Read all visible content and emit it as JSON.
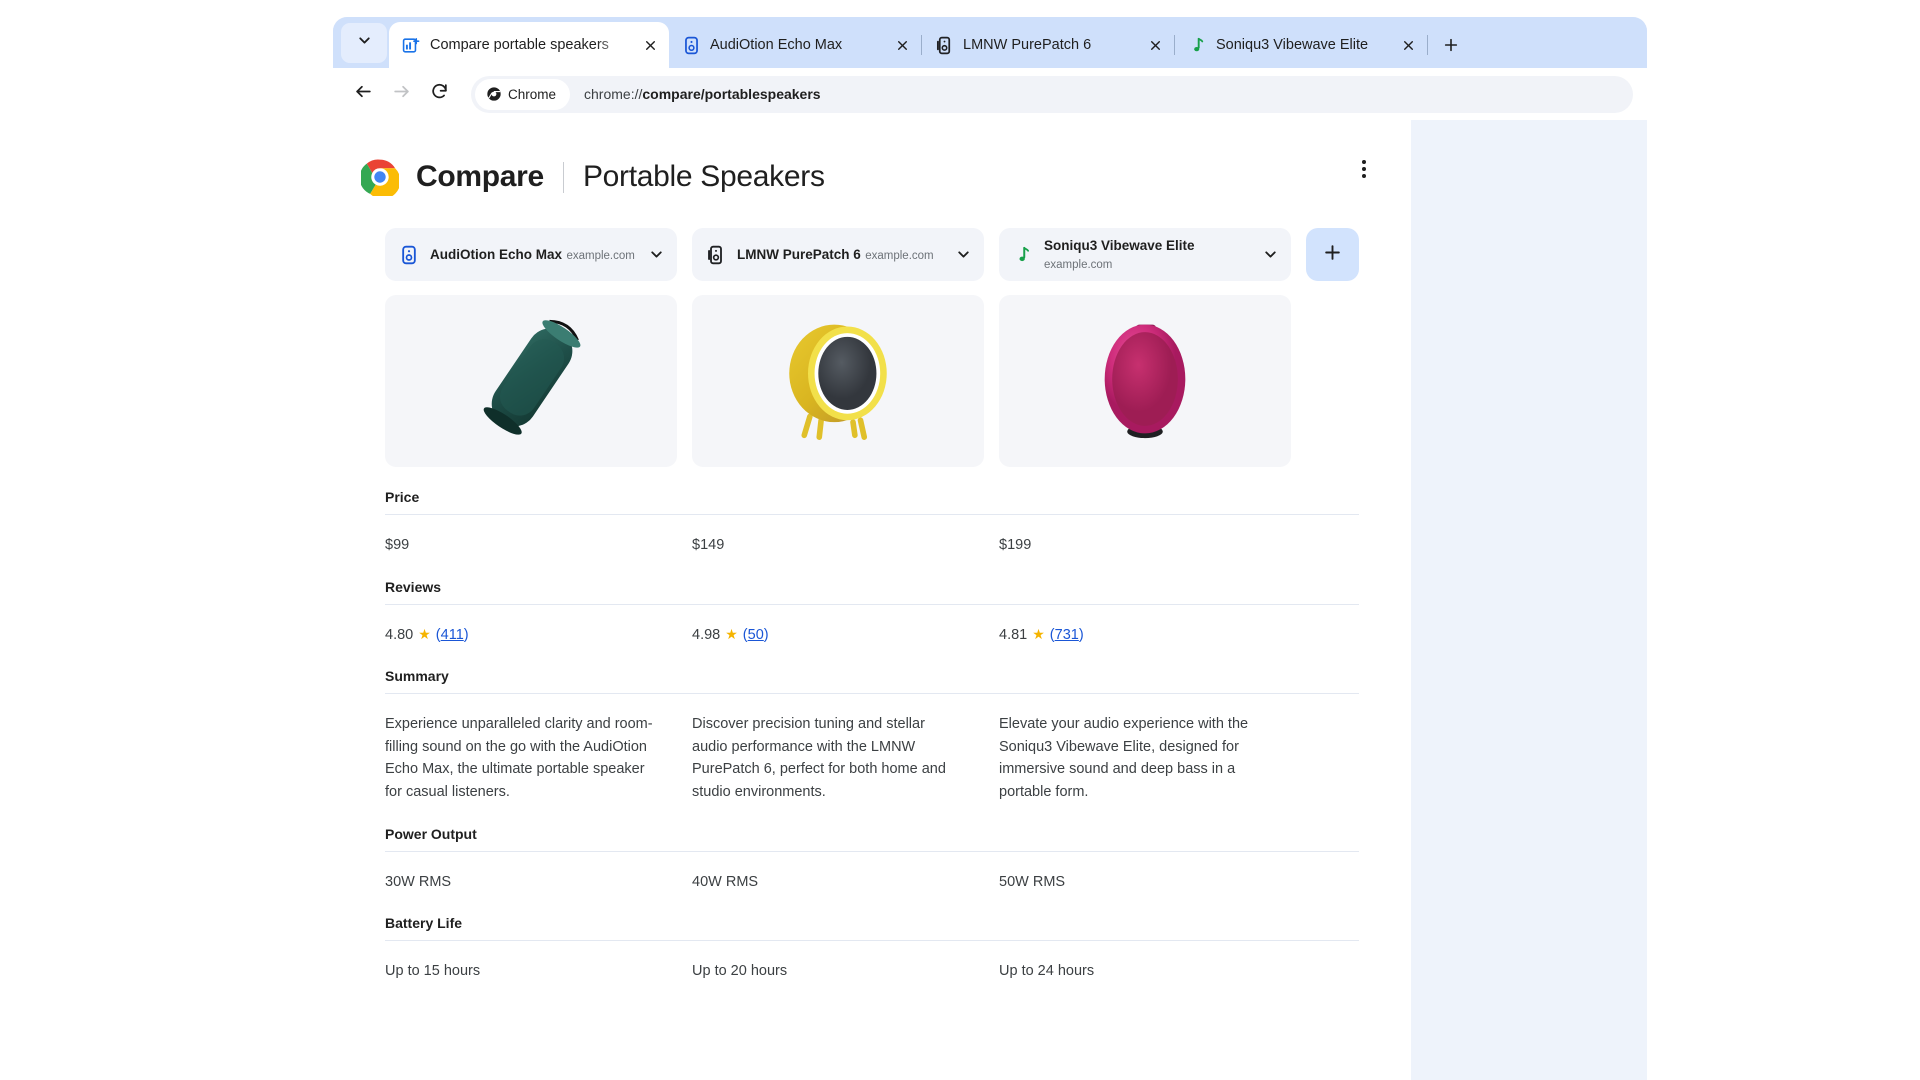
{
  "browser": {
    "tab_search_icon": "chevron-down-icon",
    "tabs": [
      {
        "title": "Compare portable speakers",
        "favicon": "compare-icon",
        "active": true,
        "close_label": "×"
      },
      {
        "title": "AudiOtion Echo Max",
        "favicon": "speaker-blue-icon",
        "active": false,
        "close_label": "×"
      },
      {
        "title": "LMNW PurePatch 6",
        "favicon": "speaker-dark-icon",
        "active": false,
        "close_label": "×"
      },
      {
        "title": "Soniqu3 Vibewave Elite",
        "favicon": "music-note-green-icon",
        "active": false,
        "close_label": "×"
      }
    ],
    "new_tab_label": "+",
    "toolbar": {
      "back_icon": "arrow-left-icon",
      "forward_icon": "arrow-right-icon",
      "reload_icon": "reload-icon",
      "chip_label": "Chrome",
      "chip_icon": "chrome-mono-icon",
      "url_prefix": "chrome://",
      "url_path": "compare/portablespeakers",
      "url_full": "chrome://compare/portablespeakers"
    }
  },
  "page": {
    "logo": "chrome-logo",
    "title": "Compare",
    "subtitle": "Portable Speakers",
    "overflow_menu_icon": "more-vertical-icon",
    "add_button_label": "+",
    "products": [
      {
        "name": "AudiOtion Echo Max",
        "site": "example.com",
        "icon": "speaker-blue-icon",
        "caret": "chevron-down-icon",
        "image": "speaker-teal-cylinder"
      },
      {
        "name": "LMNW PurePatch 6",
        "site": "example.com",
        "icon": "speaker-dark-icon",
        "caret": "chevron-down-icon",
        "image": "speaker-yellow-round"
      },
      {
        "name": "Soniqu3 Vibewave Elite",
        "site": "example.com",
        "icon": "music-note-green-icon",
        "caret": "chevron-down-icon",
        "image": "speaker-pink-oval"
      }
    ],
    "specs": [
      {
        "label": "Price",
        "values": [
          "$99",
          "$149",
          "$199"
        ]
      },
      {
        "label": "Reviews",
        "ratings": [
          {
            "score": "4.80",
            "star": "★",
            "count": "(411)",
            "count_number": "411"
          },
          {
            "score": "4.98",
            "star": "★",
            "count": "(50)",
            "count_number": "50"
          },
          {
            "score": "4.81",
            "star": "★",
            "count": "(731)",
            "count_number": "731"
          }
        ]
      },
      {
        "label": "Summary",
        "values": [
          "Experience unparalleled clarity and room-filling sound on the go with the AudiOtion Echo Max, the ultimate portable speaker for casual listeners.",
          "Discover precision tuning and stellar audio performance with the LMNW PurePatch 6, perfect for both home and studio environments.",
          "Elevate your audio experience with the Soniqu3 Vibewave Elite, designed for immersive sound and deep bass in a portable form."
        ]
      },
      {
        "label": "Power Output",
        "values": [
          "30W RMS",
          "40W RMS",
          "50W RMS"
        ]
      },
      {
        "label": "Battery Life",
        "values": [
          "Up to 15 hours",
          "Up to 20 hours",
          "Up to 24 hours"
        ]
      }
    ]
  },
  "colors": {
    "tabstrip": "#cfe0fb",
    "page_background": "#eef3fb",
    "content_background": "#ffffff",
    "accent_blue": "#1a56d6",
    "add_button": "#d2e3fd",
    "star_gold": "#f5b400",
    "cell_gray": "#f2f4f9"
  }
}
